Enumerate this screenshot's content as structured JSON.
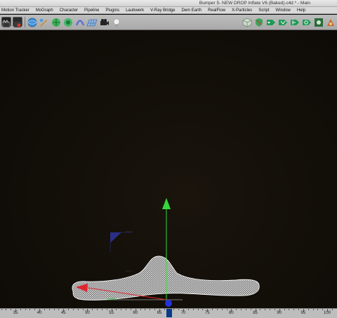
{
  "window": {
    "title": "Bumper 5- NEW DROP Inflate V6 (Baked).c4d * - Main"
  },
  "menu": {
    "items": [
      "Motion Tracker",
      "MoGraph",
      "Character",
      "Pipeline",
      "Plugins",
      "Laubwerk",
      "V-Ray Bridge",
      "Dem Earth",
      "RealFlow",
      "X-Particles",
      "Script",
      "Window",
      "Help"
    ]
  },
  "toolbar": {
    "left_icons": [
      "film-clapper-icon",
      "render-settings-icon",
      "sphere-primitive-icon",
      "pen-spline-icon",
      "subdivision-icon",
      "array-icon",
      "deformer-icon",
      "floor-grid-icon",
      "camera-icon",
      "light-bulb-icon"
    ],
    "right_icons": [
      "cube-snap-icon",
      "shield-icon",
      "tag-icon",
      "tag-icon",
      "tag-icon",
      "tag-icon",
      "tag-icon",
      "gear-icon",
      "material-icon"
    ]
  },
  "timeline": {
    "ruler_labels": [
      "35",
      "40",
      "45",
      "50",
      "55",
      "60",
      "65",
      "70",
      "75",
      "80",
      "85",
      "90",
      "95",
      "100"
    ],
    "current_frame": 67
  },
  "colors": {
    "y_axis": "#35d63a",
    "x_axis": "#e0262e",
    "z_axis": "#2433d9",
    "mesh": "#d8d8d8"
  }
}
